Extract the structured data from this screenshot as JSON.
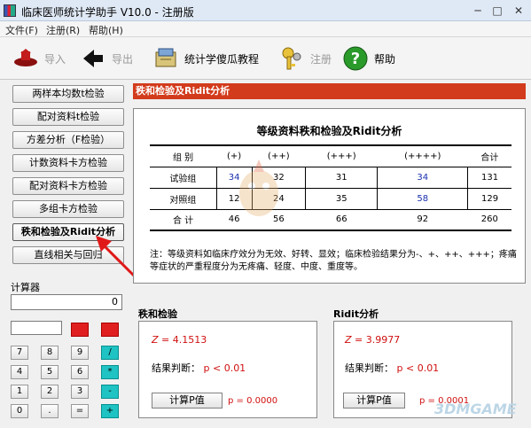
{
  "window": {
    "title": "临床医师统计学助手 V10.0 - 注册版"
  },
  "menu": [
    "文件(F)",
    "注册(R)",
    "帮助(H)"
  ],
  "toolbar": {
    "import_label": "导入",
    "export_label": "导出",
    "tutorial_label": "统计学傻瓜教程",
    "register_label": "注册",
    "help_label": "帮助"
  },
  "nav": [
    "两样本均数t检验",
    "配对资料t检验",
    "方差分析（F检验）",
    "计数资料卡方检验",
    "配对资料卡方检验",
    "多组卡方检验",
    "秩和检验及Ridit分析",
    "直线相关与回归"
  ],
  "calculator": {
    "title": "计算器",
    "display": "0",
    "keys": [
      [
        "7",
        "8",
        "9",
        "/"
      ],
      [
        "4",
        "5",
        "6",
        "*"
      ],
      [
        "1",
        "2",
        "3",
        "-"
      ],
      [
        "0",
        ".",
        "=",
        "+"
      ]
    ]
  },
  "panel_title": "秩和检验及Ridit分析",
  "report": {
    "title": "等级资料秩和检验及Ridit分析",
    "headers": [
      "组  别",
      "(+)",
      "(++)",
      "(+++)",
      "(++++)",
      "合计"
    ],
    "rows": [
      [
        "试验组",
        "34",
        "32",
        "31",
        "34",
        "131"
      ],
      [
        "对照组",
        "12",
        "24",
        "35",
        "58",
        "129"
      ],
      [
        "合  计",
        "46",
        "56",
        "66",
        "92",
        "260"
      ]
    ],
    "note": "注：等级资料如临床疗效分为无效、好转、显效；临床检验结果分为-、+、++、+++；疼痛等症状的严重程度分为无疼痛、轻度、中度、重度等。"
  },
  "ranksum": {
    "label": "秩和检验",
    "stat_symbol": "Z",
    "stat_value": "= 4.1513",
    "judge_label": "结果判断：",
    "judge_value": "p < 0.01",
    "button": "计算P值",
    "p_text": "p = 0.0000"
  },
  "ridit": {
    "label": "Ridit分析",
    "stat_symbol": "Z",
    "stat_value": "= 3.9977",
    "judge_label": "结果判断：",
    "judge_value": "p < 0.01",
    "button": "计算P值",
    "p_text": "p = 0.0001"
  },
  "watermark": "3DMGAME",
  "colors": {
    "accent_red": "#d23b1c",
    "result_red": "#d01010",
    "blue_value": "#1a2fae",
    "calc_red": "#e02020",
    "calc_cyan": "#1fc3c3"
  }
}
